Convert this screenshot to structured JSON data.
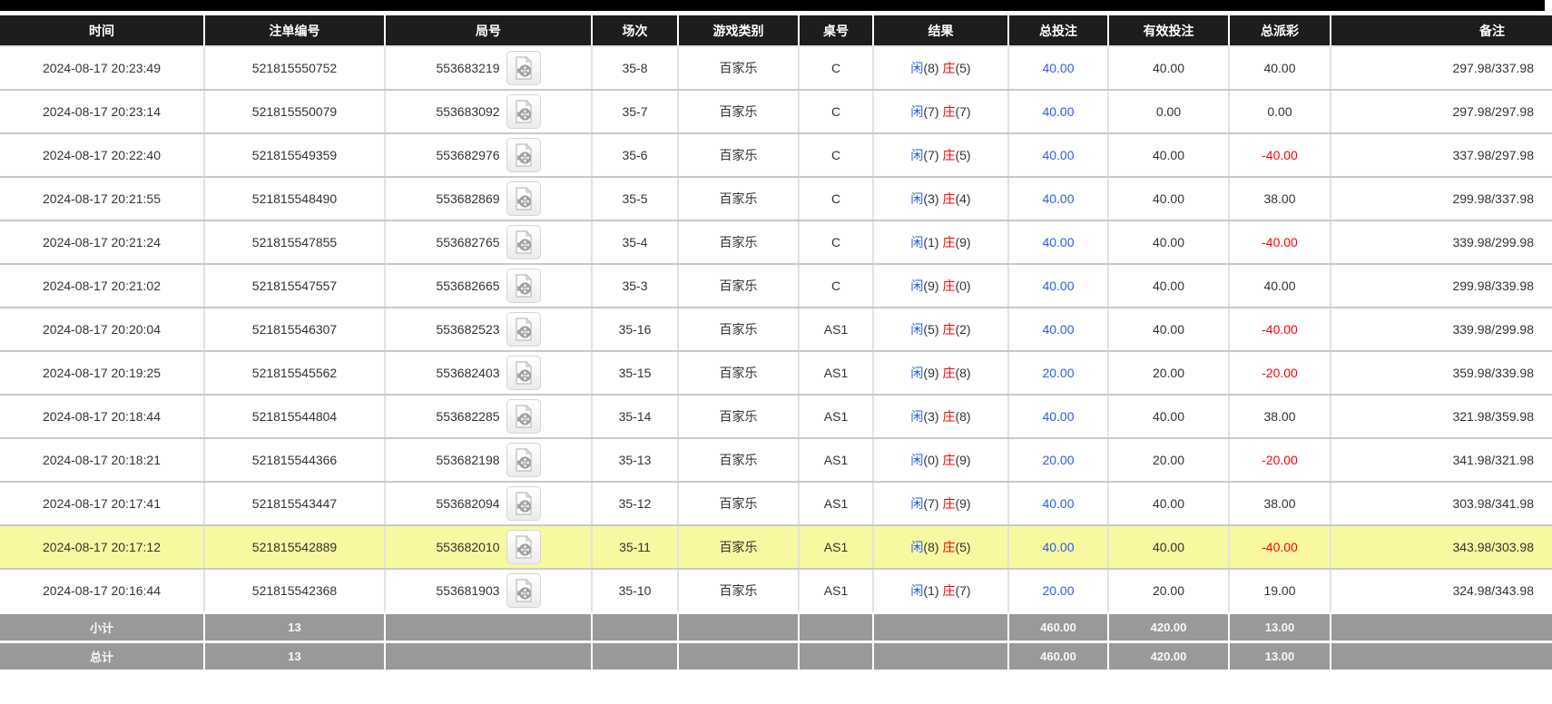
{
  "header": {
    "columns": [
      "时间",
      "注单编号",
      "局号",
      "场次",
      "游戏类别",
      "桌号",
      "结果",
      "总投注",
      "有效投注",
      "总派彩",
      "备注"
    ]
  },
  "result_labels": {
    "player": "闲",
    "banker": "庄"
  },
  "rows": [
    {
      "time": "2024-08-17 20:23:49",
      "bet_id": "521815550752",
      "round_id": "553683219",
      "session": "35-8",
      "game": "百家乐",
      "table": "C",
      "player": 8,
      "banker": 5,
      "total_bet": "40.00",
      "valid_bet": "40.00",
      "payout": "40.00",
      "remark": "297.98/337.98",
      "highlight": false
    },
    {
      "time": "2024-08-17 20:23:14",
      "bet_id": "521815550079",
      "round_id": "553683092",
      "session": "35-7",
      "game": "百家乐",
      "table": "C",
      "player": 7,
      "banker": 7,
      "total_bet": "40.00",
      "valid_bet": "0.00",
      "payout": "0.00",
      "remark": "297.98/297.98",
      "highlight": false
    },
    {
      "time": "2024-08-17 20:22:40",
      "bet_id": "521815549359",
      "round_id": "553682976",
      "session": "35-6",
      "game": "百家乐",
      "table": "C",
      "player": 7,
      "banker": 5,
      "total_bet": "40.00",
      "valid_bet": "40.00",
      "payout": "-40.00",
      "remark": "337.98/297.98",
      "highlight": false
    },
    {
      "time": "2024-08-17 20:21:55",
      "bet_id": "521815548490",
      "round_id": "553682869",
      "session": "35-5",
      "game": "百家乐",
      "table": "C",
      "player": 3,
      "banker": 4,
      "total_bet": "40.00",
      "valid_bet": "40.00",
      "payout": "38.00",
      "remark": "299.98/337.98",
      "highlight": false
    },
    {
      "time": "2024-08-17 20:21:24",
      "bet_id": "521815547855",
      "round_id": "553682765",
      "session": "35-4",
      "game": "百家乐",
      "table": "C",
      "player": 1,
      "banker": 9,
      "total_bet": "40.00",
      "valid_bet": "40.00",
      "payout": "-40.00",
      "remark": "339.98/299.98",
      "highlight": false
    },
    {
      "time": "2024-08-17 20:21:02",
      "bet_id": "521815547557",
      "round_id": "553682665",
      "session": "35-3",
      "game": "百家乐",
      "table": "C",
      "player": 9,
      "banker": 0,
      "total_bet": "40.00",
      "valid_bet": "40.00",
      "payout": "40.00",
      "remark": "299.98/339.98",
      "highlight": false
    },
    {
      "time": "2024-08-17 20:20:04",
      "bet_id": "521815546307",
      "round_id": "553682523",
      "session": "35-16",
      "game": "百家乐",
      "table": "AS1",
      "player": 5,
      "banker": 2,
      "total_bet": "40.00",
      "valid_bet": "40.00",
      "payout": "-40.00",
      "remark": "339.98/299.98",
      "highlight": false
    },
    {
      "time": "2024-08-17 20:19:25",
      "bet_id": "521815545562",
      "round_id": "553682403",
      "session": "35-15",
      "game": "百家乐",
      "table": "AS1",
      "player": 9,
      "banker": 8,
      "total_bet": "20.00",
      "valid_bet": "20.00",
      "payout": "-20.00",
      "remark": "359.98/339.98",
      "highlight": false
    },
    {
      "time": "2024-08-17 20:18:44",
      "bet_id": "521815544804",
      "round_id": "553682285",
      "session": "35-14",
      "game": "百家乐",
      "table": "AS1",
      "player": 3,
      "banker": 8,
      "total_bet": "40.00",
      "valid_bet": "40.00",
      "payout": "38.00",
      "remark": "321.98/359.98",
      "highlight": false
    },
    {
      "time": "2024-08-17 20:18:21",
      "bet_id": "521815544366",
      "round_id": "553682198",
      "session": "35-13",
      "game": "百家乐",
      "table": "AS1",
      "player": 0,
      "banker": 9,
      "total_bet": "20.00",
      "valid_bet": "20.00",
      "payout": "-20.00",
      "remark": "341.98/321.98",
      "highlight": false
    },
    {
      "time": "2024-08-17 20:17:41",
      "bet_id": "521815543447",
      "round_id": "553682094",
      "session": "35-12",
      "game": "百家乐",
      "table": "AS1",
      "player": 7,
      "banker": 9,
      "total_bet": "40.00",
      "valid_bet": "40.00",
      "payout": "38.00",
      "remark": "303.98/341.98",
      "highlight": false
    },
    {
      "time": "2024-08-17 20:17:12",
      "bet_id": "521815542889",
      "round_id": "553682010",
      "session": "35-11",
      "game": "百家乐",
      "table": "AS1",
      "player": 8,
      "banker": 5,
      "total_bet": "40.00",
      "valid_bet": "40.00",
      "payout": "-40.00",
      "remark": "343.98/303.98",
      "highlight": true
    },
    {
      "time": "2024-08-17 20:16:44",
      "bet_id": "521815542368",
      "round_id": "553681903",
      "session": "35-10",
      "game": "百家乐",
      "table": "AS1",
      "player": 1,
      "banker": 7,
      "total_bet": "20.00",
      "valid_bet": "20.00",
      "payout": "19.00",
      "remark": "324.98/343.98",
      "highlight": false
    }
  ],
  "totals": {
    "subtotal_label": "小计",
    "total_label": "总计",
    "subtotal_count": "13",
    "total_count": "13",
    "subtotal": {
      "total_bet": "460.00",
      "valid_bet": "420.00",
      "payout": "13.00"
    },
    "total": {
      "total_bet": "460.00",
      "valid_bet": "420.00",
      "payout": "13.00"
    }
  },
  "icons": {
    "round_video": "video-replay-icon"
  },
  "colors": {
    "header_bg": "#1d1d1d",
    "top_bar": "#000000",
    "link_blue": "#2b5ce6",
    "player_blue": "#2b5ce6",
    "banker_red": "#ff0000",
    "negative_red": "#ff0000",
    "highlight_yellow": "#f8f8a1",
    "totals_gray": "#999999",
    "row_divider": "#c9c9c9"
  }
}
